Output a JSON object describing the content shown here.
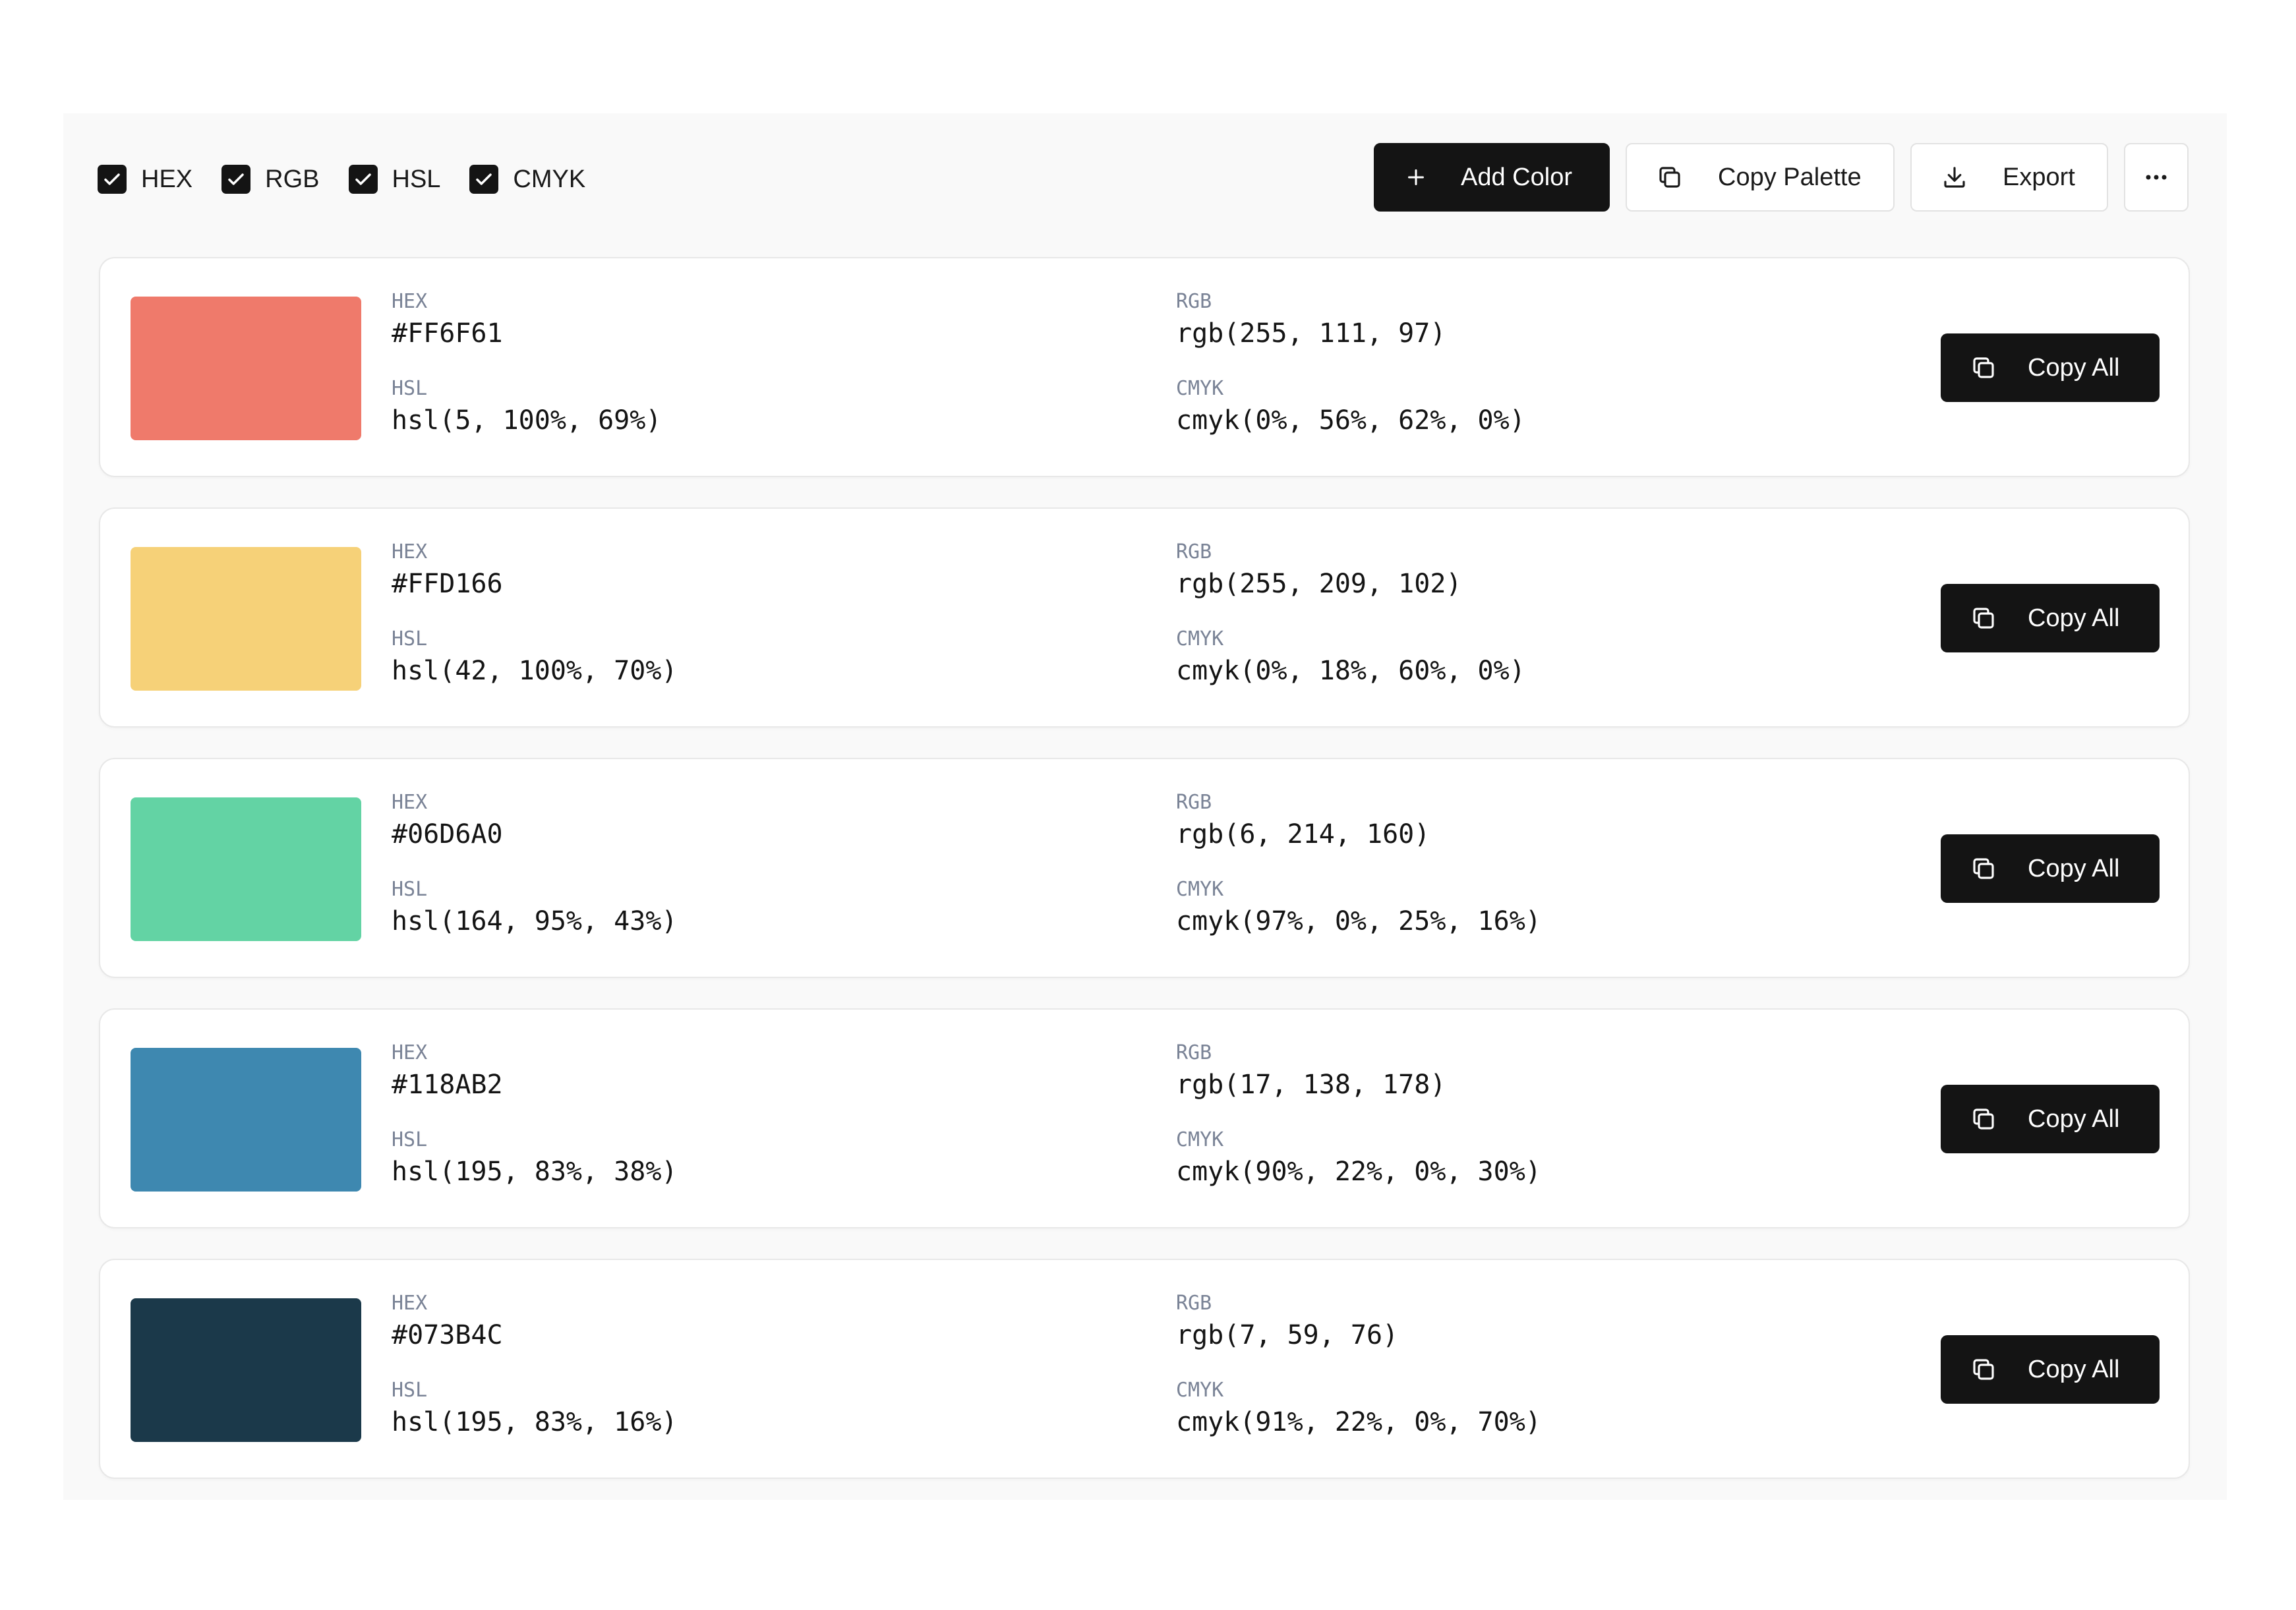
{
  "filters": [
    {
      "label": "HEX",
      "checked": true
    },
    {
      "label": "RGB",
      "checked": true
    },
    {
      "label": "HSL",
      "checked": true
    },
    {
      "label": "CMYK",
      "checked": true
    }
  ],
  "toolbar": {
    "add_label": "Add Color",
    "copy_palette_label": "Copy Palette",
    "export_label": "Export",
    "more_icon": "more-horizontal-icon"
  },
  "labels": {
    "hex": "HEX",
    "rgb": "RGB",
    "hsl": "HSL",
    "cmyk": "CMYK",
    "copy_all": "Copy All"
  },
  "colors": [
    {
      "swatch": "#EF7A6B",
      "hex": "#FF6F61",
      "rgb": "rgb(255, 111, 97)",
      "hsl": "hsl(5, 100%, 69%)",
      "cmyk": "cmyk(0%, 56%, 62%, 0%)"
    },
    {
      "swatch": "#F6D178",
      "hex": "#FFD166",
      "rgb": "rgb(255, 209, 102)",
      "hsl": "hsl(42, 100%, 70%)",
      "cmyk": "cmyk(0%, 18%, 60%, 0%)"
    },
    {
      "swatch": "#63D3A4",
      "hex": "#06D6A0",
      "rgb": "rgb(6, 214, 160)",
      "hsl": "hsl(164, 95%, 43%)",
      "cmyk": "cmyk(97%, 0%, 25%, 16%)"
    },
    {
      "swatch": "#3E88B0",
      "hex": "#118AB2",
      "rgb": "rgb(17, 138, 178)",
      "hsl": "hsl(195, 83%, 38%)",
      "cmyk": "cmyk(90%, 22%, 0%, 30%)"
    },
    {
      "swatch": "#1B394A",
      "hex": "#073B4C",
      "rgb": "rgb(7, 59, 76)",
      "hsl": "hsl(195, 83%, 16%)",
      "cmyk": "cmyk(91%, 22%, 0%, 70%)"
    }
  ]
}
